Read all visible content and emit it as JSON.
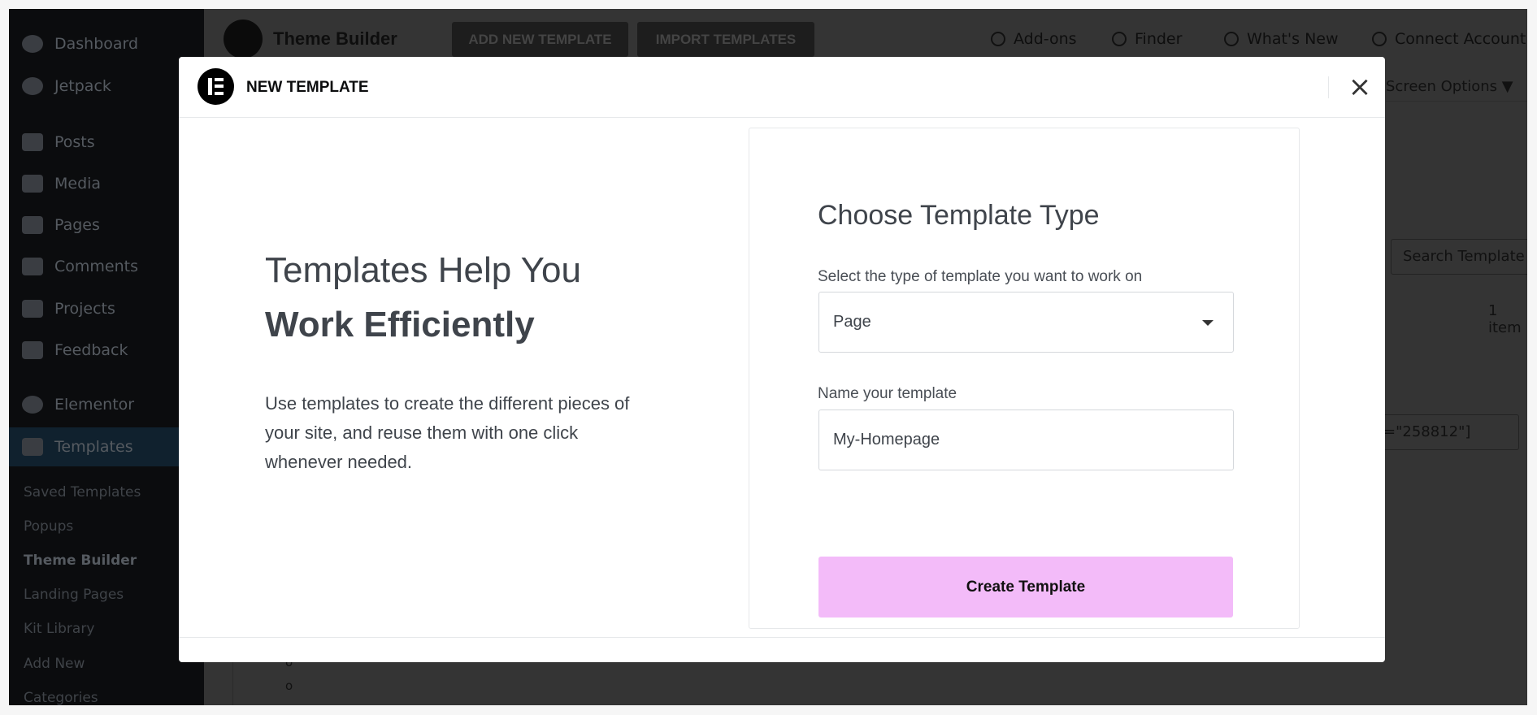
{
  "sidebar": {
    "items": [
      {
        "label": "Dashboard",
        "icon": "dashboard-icon"
      },
      {
        "label": "Jetpack",
        "icon": "jetpack-icon"
      },
      {
        "label": "Posts",
        "icon": "pin-icon"
      },
      {
        "label": "Media",
        "icon": "media-icon"
      },
      {
        "label": "Pages",
        "icon": "pages-icon"
      },
      {
        "label": "Comments",
        "icon": "comment-icon"
      },
      {
        "label": "Projects",
        "icon": "pin-icon"
      },
      {
        "label": "Feedback",
        "icon": "feedback-icon"
      },
      {
        "label": "Elementor",
        "icon": "elementor-icon"
      },
      {
        "label": "Templates",
        "icon": "folder-icon"
      }
    ],
    "subitems": [
      "Saved Templates",
      "Popups",
      "Theme Builder",
      "Landing Pages",
      "Kit Library",
      "Add New",
      "Categories"
    ]
  },
  "topbar": {
    "title": "Theme Builder",
    "add_new": "ADD NEW TEMPLATE",
    "import": "IMPORT TEMPLATES",
    "addons": "Add-ons",
    "finder": "Finder",
    "whats_new": "What's New",
    "connect": "Connect Account"
  },
  "background": {
    "screen_options": "Screen Options ▼",
    "search_placeholder": "Search Template",
    "item_count": "1 item",
    "shortcode": "=\"258812\"]",
    "radio1": "o",
    "radio2": "o"
  },
  "modal": {
    "title": "NEW TEMPLATE",
    "close": "×",
    "intro_line1": "Templates Help You",
    "intro_line2": "Work Efficiently",
    "intro_text": "Use templates to create the different pieces of your site, and reuse them with one click whenever needed.",
    "form": {
      "heading": "Choose Template Type",
      "type_label": "Select the type of template you want to work on",
      "type_value": "Page",
      "name_label": "Name your template",
      "name_value": "My-Homepage",
      "submit": "Create Template"
    }
  },
  "colors": {
    "accent": "#f3bbf9",
    "overlay_sidebar": "#0b0c0e",
    "overlay_content": "#343434"
  }
}
